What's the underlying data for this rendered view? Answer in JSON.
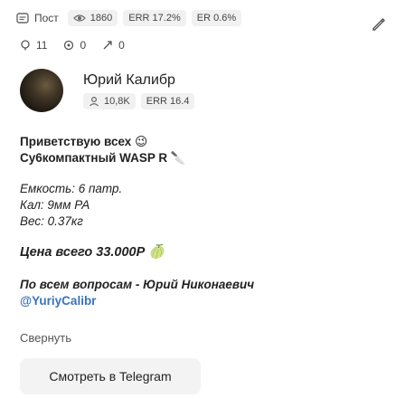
{
  "stats_top": {
    "post_label": "Пост",
    "views": "1860",
    "err": "ERR 17.2%",
    "er": "ER 0.6%"
  },
  "stats_bottom": {
    "reposts": "11",
    "comments": "0",
    "reactions": "0"
  },
  "author": {
    "name": "Юрий Калибр",
    "subscribers": "10,8K",
    "err": "ERR 16.4"
  },
  "post": {
    "line1": "Приветствую всех 😉",
    "line2": "Cy6компактный WASP R 🔪",
    "spec_weight": "Емкость: 6 патр.",
    "spec_caliber": "Кал: 9мм PA",
    "spec_mass": "Вес: 0.37кг",
    "price": "Цена всего 33.000Р 🍈",
    "footer_line": "По всем вопросам - Юрий Никонаевич",
    "handle": "@YuriyCalibr"
  },
  "actions": {
    "collapse": "Свернуть",
    "telegram": "Смотреть в Telegram"
  },
  "icons": {
    "post": "post-icon",
    "views": "eye-icon",
    "edit": "edit-pencil-icon",
    "repost": "repost-icon",
    "comment": "comment-icon",
    "reaction": "reaction-icon",
    "subscribers": "subscribers-icon"
  }
}
